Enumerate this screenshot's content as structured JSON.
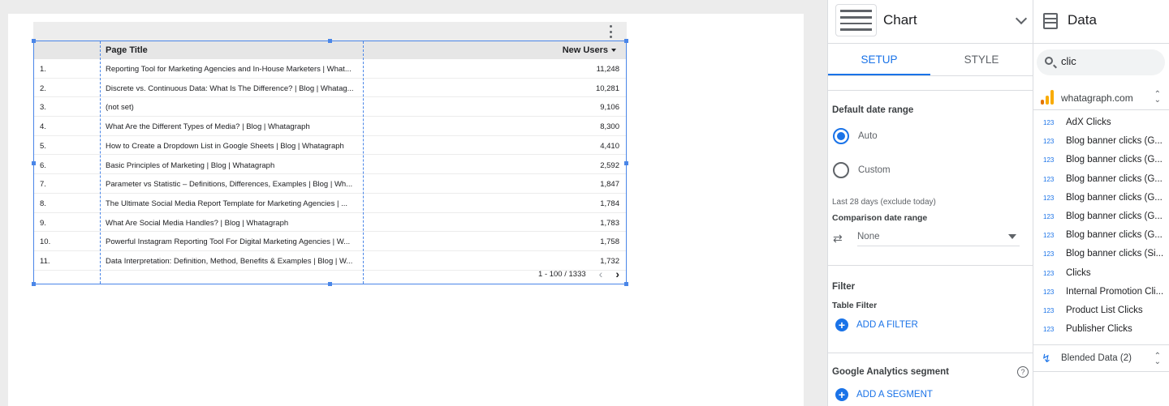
{
  "table": {
    "headers": {
      "page_title": "Page Title",
      "new_users": "New Users"
    },
    "rows": [
      {
        "num": "1.",
        "title": "Reporting Tool for Marketing Agencies and In-House Marketers | What...",
        "value": "11,248"
      },
      {
        "num": "2.",
        "title": "Discrete vs. Continuous Data: What Is The Difference? | Blog | Whatag...",
        "value": "10,281"
      },
      {
        "num": "3.",
        "title": "(not set)",
        "value": "9,106"
      },
      {
        "num": "4.",
        "title": "What Are the Different Types of Media? | Blog | Whatagraph",
        "value": "8,300"
      },
      {
        "num": "5.",
        "title": "How to Create a Dropdown List in Google Sheets | Blog | Whatagraph",
        "value": "4,410"
      },
      {
        "num": "6.",
        "title": "Basic Principles of Marketing | Blog | Whatagraph",
        "value": "2,592"
      },
      {
        "num": "7.",
        "title": "Parameter vs Statistic – Definitions, Differences, Examples | Blog | Wh...",
        "value": "1,847"
      },
      {
        "num": "8.",
        "title": "The Ultimate Social Media Report Template for Marketing Agencies | ...",
        "value": "1,784"
      },
      {
        "num": "9.",
        "title": "What Are Social Media Handles? | Blog | Whatagraph",
        "value": "1,783"
      },
      {
        "num": "10.",
        "title": "Powerful Instagram Reporting Tool For Digital Marketing Agencies | W...",
        "value": "1,758"
      },
      {
        "num": "11.",
        "title": "Data Interpretation: Definition, Method, Benefits & Examples | Blog | W...",
        "value": "1,732"
      }
    ],
    "pagination": "1 - 100 / 1333"
  },
  "chart_panel": {
    "title": "Chart",
    "tabs": {
      "setup": "SETUP",
      "style": "STYLE"
    },
    "default_date_range": "Default date range",
    "auto": "Auto",
    "custom": "Custom",
    "date_note": "Last 28 days (exclude today)",
    "comparison_label": "Comparison date range",
    "comparison_value": "None",
    "filter_label": "Filter",
    "table_filter": "Table Filter",
    "add_filter": "ADD A FILTER",
    "ga_segment": "Google Analytics segment",
    "add_segment": "ADD A SEGMENT"
  },
  "data_panel": {
    "title": "Data",
    "search_value": "clic",
    "source": "whatagraph.com",
    "field_type": "123",
    "fields": [
      "AdX Clicks",
      "Blog banner clicks (G...",
      "Blog banner clicks (G...",
      "Blog banner clicks (G...",
      "Blog banner clicks (G...",
      "Blog banner clicks (G...",
      "Blog banner clicks (G...",
      "Blog banner clicks (Si...",
      "Clicks",
      "Internal Promotion Cli...",
      "Product List Clicks",
      "Publisher Clicks"
    ],
    "blended": "Blended Data (2)"
  },
  "colors": {
    "accent": "#1a73e8",
    "selection": "#4a86e8",
    "ga_orange": "#f9ab00",
    "ga_dark_orange": "#e37400"
  },
  "icons": [
    "more-vert-icon",
    "sort-desc-icon",
    "chevron-left-icon",
    "chevron-right-icon",
    "table-chart-icon",
    "chevron-down-icon",
    "compare-arrows-icon",
    "add-circle-icon",
    "help-icon",
    "data-table-icon",
    "search-icon",
    "google-analytics-icon",
    "unfold-icon",
    "blend-icon"
  ]
}
